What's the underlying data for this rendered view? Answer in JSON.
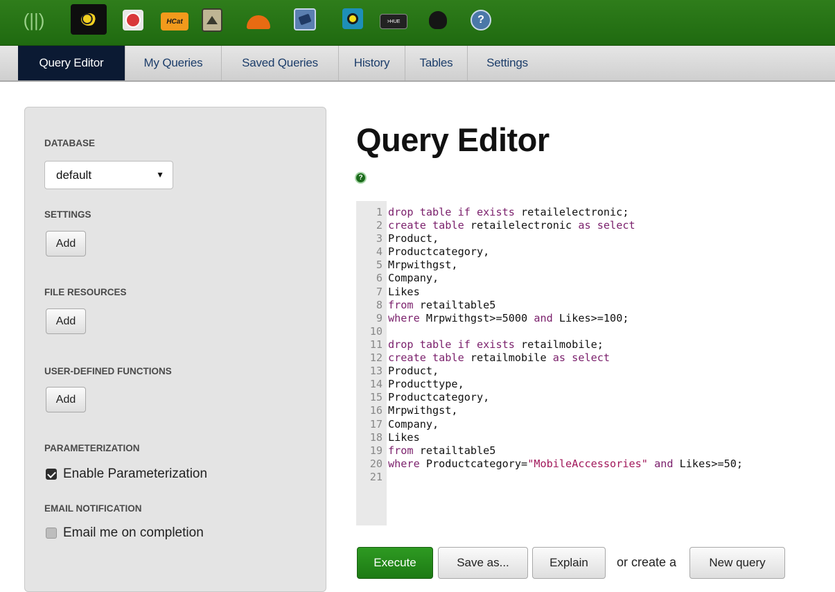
{
  "appbar": {
    "icons": [
      {
        "name": "hue-home-icon",
        "glyph": "(||)"
      },
      {
        "name": "beeswax-icon"
      },
      {
        "name": "pig-icon"
      },
      {
        "name": "hcat-icon",
        "text": "HCat"
      },
      {
        "name": "oozie-icon"
      },
      {
        "name": "job-designer-icon"
      },
      {
        "name": "shell-icon"
      },
      {
        "name": "file-browser-icon"
      },
      {
        "name": "hue-terminal-icon",
        "text": ">HUE"
      },
      {
        "name": "user-admin-icon"
      },
      {
        "name": "help-icon",
        "glyph": "?"
      }
    ]
  },
  "tabs": [
    {
      "label": "Query Editor",
      "active": true
    },
    {
      "label": "My Queries",
      "active": false
    },
    {
      "label": "Saved Queries",
      "active": false
    },
    {
      "label": "History",
      "active": false
    },
    {
      "label": "Tables",
      "active": false
    },
    {
      "label": "Settings",
      "active": false
    }
  ],
  "sidebar": {
    "database_heading": "DATABASE",
    "database_value": "default",
    "settings_heading": "SETTINGS",
    "file_resources_heading": "FILE RESOURCES",
    "udf_heading": "USER-DEFINED FUNCTIONS",
    "add_label": "Add",
    "parameterization_heading": "PARAMETERIZATION",
    "enable_parameterization_label": "Enable Parameterization",
    "enable_parameterization_checked": true,
    "email_heading": "EMAIL NOTIFICATION",
    "email_label": "Email me on completion",
    "email_checked": false
  },
  "main": {
    "title": "Query Editor",
    "help_glyph": "?",
    "code_lines": [
      {
        "n": "1",
        "parts": [
          {
            "t": "drop table if exists ",
            "c": "kw"
          },
          {
            "t": "retailelectronic;"
          }
        ]
      },
      {
        "n": "2",
        "parts": [
          {
            "t": "create table ",
            "c": "kw"
          },
          {
            "t": "retailelectronic "
          },
          {
            "t": "as select",
            "c": "kw"
          }
        ]
      },
      {
        "n": "3",
        "parts": [
          {
            "t": "Product,"
          }
        ]
      },
      {
        "n": "4",
        "parts": [
          {
            "t": "Productcategory,"
          }
        ]
      },
      {
        "n": "5",
        "parts": [
          {
            "t": "Mrpwithgst,"
          }
        ]
      },
      {
        "n": "6",
        "parts": [
          {
            "t": "Company,"
          }
        ]
      },
      {
        "n": "7",
        "parts": [
          {
            "t": "Likes"
          }
        ]
      },
      {
        "n": "8",
        "parts": [
          {
            "t": "from ",
            "c": "kw"
          },
          {
            "t": "retailtable5"
          }
        ]
      },
      {
        "n": "9",
        "parts": [
          {
            "t": "where ",
            "c": "kw"
          },
          {
            "t": "Mrpwithgst>=5000 "
          },
          {
            "t": "and ",
            "c": "kw"
          },
          {
            "t": "Likes>=100;"
          }
        ]
      },
      {
        "n": "10",
        "parts": []
      },
      {
        "n": "11",
        "parts": [
          {
            "t": "drop table if exists ",
            "c": "kw"
          },
          {
            "t": "retailmobile;"
          }
        ]
      },
      {
        "n": "12",
        "parts": [
          {
            "t": "create table ",
            "c": "kw"
          },
          {
            "t": "retailmobile "
          },
          {
            "t": "as select",
            "c": "kw"
          }
        ]
      },
      {
        "n": "13",
        "parts": [
          {
            "t": "Product,"
          }
        ]
      },
      {
        "n": "14",
        "parts": [
          {
            "t": "Producttype,"
          }
        ]
      },
      {
        "n": "15",
        "parts": [
          {
            "t": "Productcategory,"
          }
        ]
      },
      {
        "n": "16",
        "parts": [
          {
            "t": "Mrpwithgst,"
          }
        ]
      },
      {
        "n": "17",
        "parts": [
          {
            "t": "Company,"
          }
        ]
      },
      {
        "n": "18",
        "parts": [
          {
            "t": "Likes"
          }
        ]
      },
      {
        "n": "19",
        "parts": [
          {
            "t": "from ",
            "c": "kw"
          },
          {
            "t": "retailtable5"
          }
        ]
      },
      {
        "n": "20",
        "parts": [
          {
            "t": "where ",
            "c": "kw"
          },
          {
            "t": "Productcategory="
          },
          {
            "t": "\"MobileAccessories\"",
            "c": "str"
          },
          {
            "t": " and ",
            "c": "kw"
          },
          {
            "t": "Likes>=50;"
          }
        ]
      },
      {
        "n": "21",
        "parts": []
      }
    ],
    "execute_label": "Execute",
    "save_as_label": "Save as...",
    "explain_label": "Explain",
    "or_create_text": "or create a",
    "new_query_label": "New query"
  },
  "colors": {
    "appbar_green": "#2f7d1b",
    "active_tab": "#0b1a33",
    "execute_green": "#2e9a22",
    "keyword": "#7a1f6b",
    "string": "#a1175a"
  }
}
